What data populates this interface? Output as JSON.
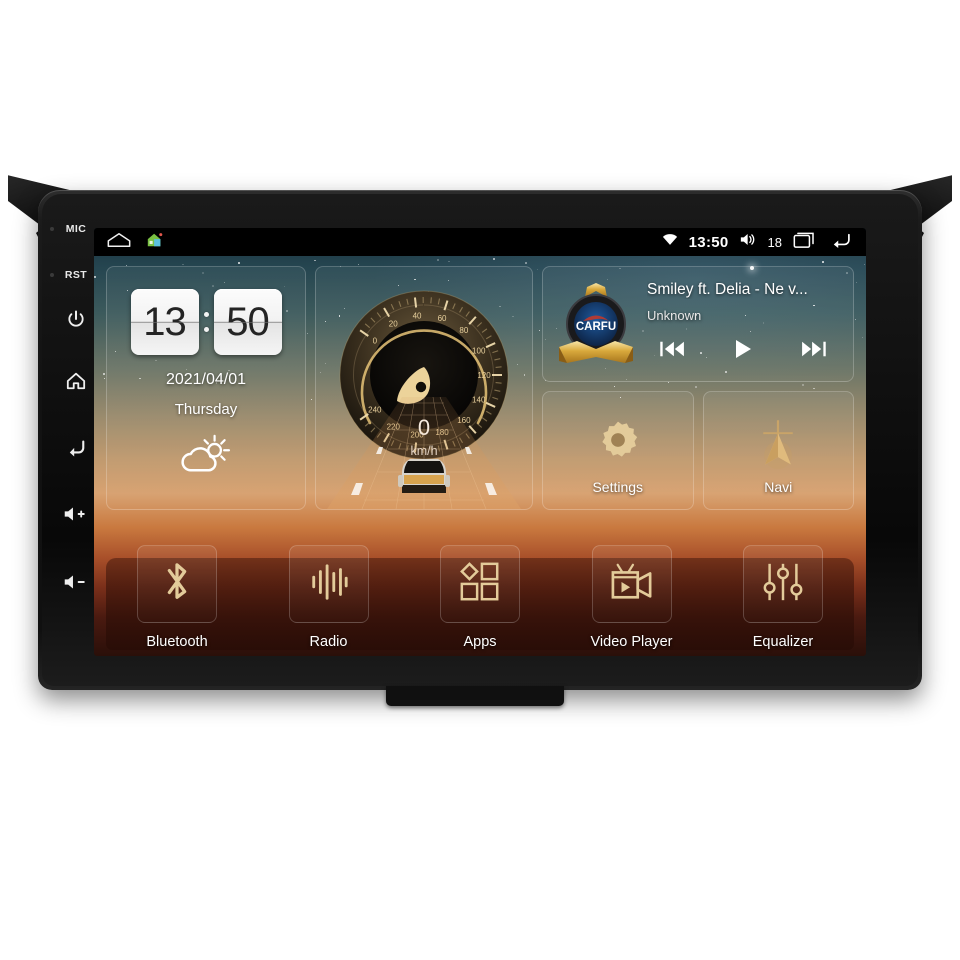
{
  "device": {
    "label": "android-car-head-unit",
    "hardware_keys": [
      {
        "name": "mic",
        "label": "MIC",
        "type": "text"
      },
      {
        "name": "reset",
        "label": "RST",
        "type": "text"
      },
      {
        "name": "power",
        "label": "",
        "type": "power-icon"
      },
      {
        "name": "home",
        "label": "",
        "type": "home-icon"
      },
      {
        "name": "back",
        "label": "",
        "type": "back-icon"
      },
      {
        "name": "volume-up",
        "label": "+",
        "type": "volume-up-icon"
      },
      {
        "name": "volume-down",
        "label": "-",
        "type": "volume-down-icon"
      }
    ]
  },
  "statusbar": {
    "home_icon": "home-outline-icon",
    "launcher_icon": "house-launcher-icon",
    "wifi_icon": "wifi-icon",
    "time": "13:50",
    "volume_icon": "volume-icon",
    "volume_level": "18",
    "recents_icon": "recent-apps-icon",
    "back_icon": "back-arrow-icon"
  },
  "clock_widget": {
    "hours": "13",
    "minutes": "50",
    "date": "2021/04/01",
    "weekday": "Thursday",
    "weather_icon": "partly-cloudy-icon"
  },
  "speedometer": {
    "value": "0",
    "unit": "km/h",
    "ticks": [
      "0",
      "20",
      "40",
      "60",
      "80",
      "100",
      "120",
      "140",
      "160",
      "180",
      "200",
      "220",
      "240"
    ],
    "min": 0,
    "max": 240,
    "accent": "#e8c478"
  },
  "music": {
    "logo_text": "CARFU",
    "title": "Smiley ft. Delia - Ne v...",
    "artist": "Unknown",
    "prev_icon": "previous-track-icon",
    "play_icon": "play-icon",
    "next_icon": "next-track-icon"
  },
  "tiles": [
    {
      "name": "settings",
      "label": "Settings",
      "icon": "gear-icon"
    },
    {
      "name": "navi",
      "label": "Navi",
      "icon": "navigation-arrow-icon"
    }
  ],
  "dock": [
    {
      "name": "bluetooth",
      "label": "Bluetooth",
      "icon": "bluetooth-icon"
    },
    {
      "name": "radio",
      "label": "Radio",
      "icon": "radio-waves-icon"
    },
    {
      "name": "apps",
      "label": "Apps",
      "icon": "apps-grid-icon"
    },
    {
      "name": "video-player",
      "label": "Video Player",
      "icon": "video-camera-icon"
    },
    {
      "name": "equalizer",
      "label": "Equalizer",
      "icon": "equalizer-sliders-icon"
    }
  ],
  "colors": {
    "gold": "#e0bb7d",
    "screen_top": "#18313c",
    "screen_bottom": "#2a0f09",
    "bezel": "#121212"
  }
}
